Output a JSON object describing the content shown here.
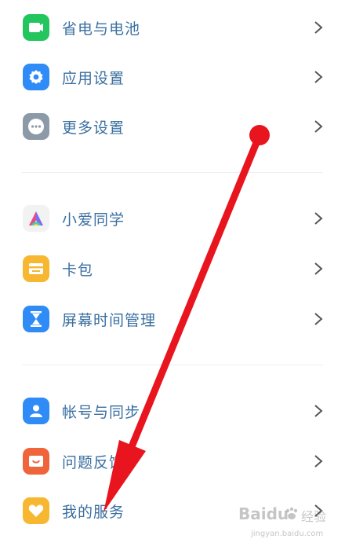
{
  "groups": [
    {
      "items": [
        {
          "label": "省电与电池",
          "icon": "battery-icon",
          "color": "#22c55e"
        },
        {
          "label": "应用设置",
          "icon": "gear-icon",
          "color": "#2f8cf6"
        },
        {
          "label": "更多设置",
          "icon": "more-dots-icon",
          "color": "#8c9aa8"
        }
      ]
    },
    {
      "items": [
        {
          "label": "小爱同学",
          "icon": "xiaoai-logo-icon",
          "color": "#f2f2f2"
        },
        {
          "label": "卡包",
          "icon": "wallet-icon",
          "color": "#f7b731"
        },
        {
          "label": "屏幕时间管理",
          "icon": "hourglass-icon",
          "color": "#2f8cf6"
        }
      ]
    },
    {
      "items": [
        {
          "label": "帐号与同步",
          "icon": "account-icon",
          "color": "#2f8cf6"
        },
        {
          "label": "问题反馈",
          "icon": "feedback-icon",
          "color": "#f0643c"
        },
        {
          "label": "我的服务",
          "icon": "heart-icon",
          "color": "#f7b731"
        }
      ]
    }
  ],
  "annotation": {
    "arrow_color": "#e8141e",
    "icon": "red-arrow-annotation"
  },
  "watermark": {
    "brand": "Baidu",
    "text": "经验",
    "url": "jingyan.baidu.com"
  }
}
